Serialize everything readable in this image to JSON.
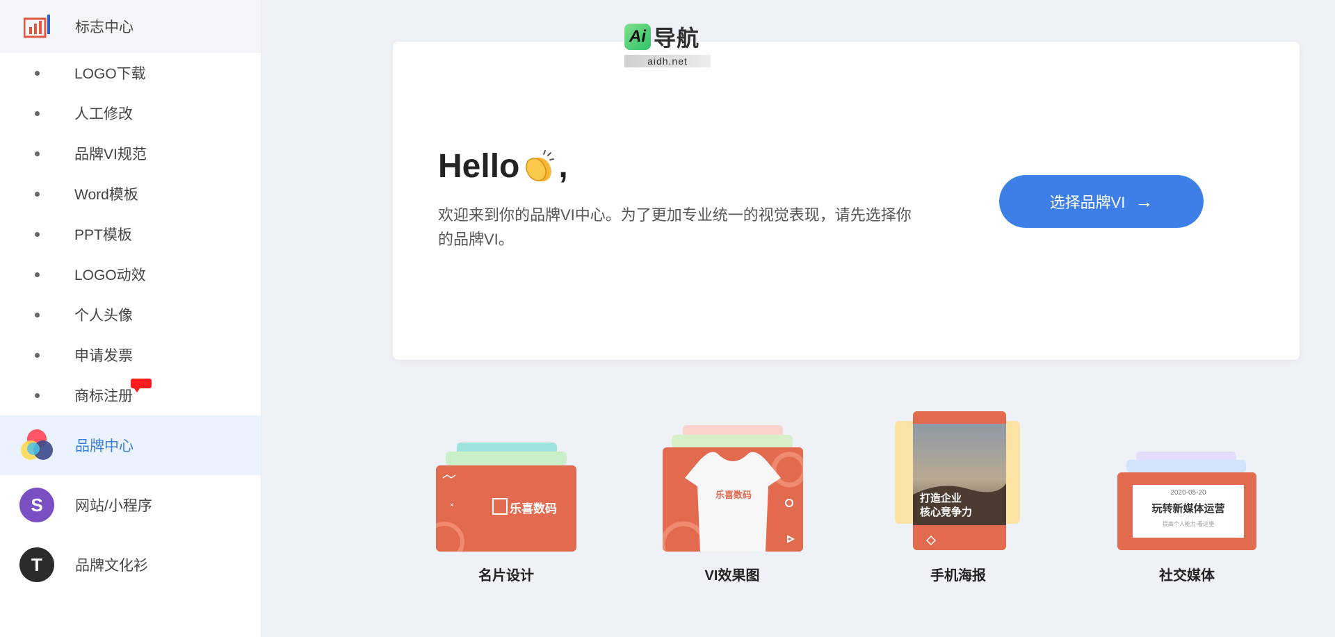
{
  "sidebar": {
    "top": {
      "label": "标志中心",
      "icon": "bar-chart-icon"
    },
    "items": [
      {
        "label": "LOGO下载"
      },
      {
        "label": "人工修改"
      },
      {
        "label": "品牌VI规范"
      },
      {
        "label": "Word模板"
      },
      {
        "label": "PPT模板"
      },
      {
        "label": "LOGO动效"
      },
      {
        "label": "个人头像"
      },
      {
        "label": "申请发票"
      },
      {
        "label": "商标注册"
      }
    ],
    "main": [
      {
        "label": "品牌中心",
        "icon": "color-circles-icon",
        "active": true
      },
      {
        "label": "网站/小程序",
        "icon": "s-letter-icon",
        "glyph": "S"
      },
      {
        "label": "品牌文化衫",
        "icon": "t-letter-icon",
        "glyph": "T"
      }
    ]
  },
  "watermark": {
    "ai": "Ai",
    "title": "导航",
    "url": "aidh.net"
  },
  "hello": {
    "title_before": "Hello",
    "title_after": ",",
    "description": "欢迎来到你的品牌VI中心。为了更加专业统一的视觉表现，请先选择你的品牌VI。",
    "cta_label": "选择品牌VI",
    "cta_icon": "arrow-right-icon"
  },
  "tiles": [
    {
      "caption": "名片设计",
      "card_text": "乐喜数码"
    },
    {
      "caption": "VI效果图",
      "card_text": "乐喜数码"
    },
    {
      "caption": "手机海报",
      "card_text_line1": "打造企业",
      "card_text_line2": "核心竞争力"
    },
    {
      "caption": "社交媒体",
      "date": "2020-05-20",
      "headline": "玩转新媒体运营",
      "sub": "提高个人能力 看这里"
    }
  ],
  "colors": {
    "accent": "#3d7fe6",
    "card_orange": "#e26a4e",
    "badge_red": "#ff1e1e"
  }
}
